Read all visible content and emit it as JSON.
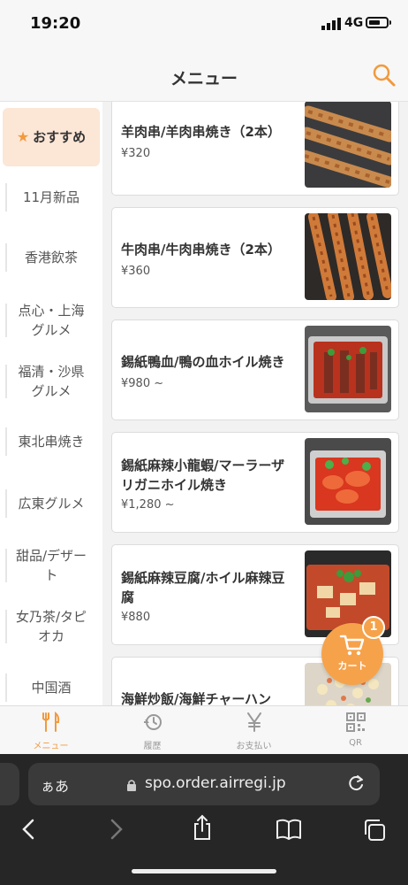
{
  "status": {
    "time": "19:20",
    "network": "4G"
  },
  "header": {
    "title": "メニュー"
  },
  "sidebar": {
    "items": [
      {
        "label": "おすすめ",
        "active": true
      },
      {
        "label": "11月新品"
      },
      {
        "label": "香港飲茶"
      },
      {
        "label": "点心・上海グルメ",
        "line1": "点心・上海",
        "line2": "グルメ"
      },
      {
        "label": "福清・沙県グルメ",
        "line1": "福清・沙県",
        "line2": "グルメ"
      },
      {
        "label": "東北串焼き"
      },
      {
        "label": "広東グルメ"
      },
      {
        "label": "甜品/デザート",
        "line1": "甜品/デザー",
        "line2": "ト"
      },
      {
        "label": "女乃茶/タピオカ",
        "line1": "女乃茶/タピ",
        "line2": "オカ"
      },
      {
        "label": "中国酒"
      }
    ]
  },
  "products": [
    {
      "name": "羊肉串/羊肉串焼き（2本）",
      "price": "¥320"
    },
    {
      "name": "牛肉串/牛肉串焼き（2本）",
      "price": "¥360"
    },
    {
      "name": "錫紙鴨血/鴨の血ホイル焼き",
      "price": "¥980 ~"
    },
    {
      "name": "錫紙麻辣小龍蝦/マーラーザリガニホイル焼き",
      "line1": "錫紙麻辣小龍蝦/マーラーザ",
      "line2": "リガニホイル焼き",
      "price": "¥1,280 ~"
    },
    {
      "name": "錫紙麻辣豆腐/ホイル麻辣豆腐",
      "line1": "錫紙麻辣豆腐/ホイル麻辣豆",
      "line2": "腐",
      "price": "¥880"
    },
    {
      "name": "海鮮炒飯/海鮮チャーハン"
    }
  ],
  "cart": {
    "label": "カート",
    "count": "1"
  },
  "tabbar": {
    "tabs": [
      {
        "label": "メニュー",
        "icon": "fork-knife-icon",
        "active": true
      },
      {
        "label": "履歴",
        "icon": "history-icon"
      },
      {
        "label": "お支払い",
        "icon": "yen-icon"
      },
      {
        "label": "QR",
        "icon": "qr-code-icon"
      }
    ]
  },
  "browser": {
    "text_size_label": "ぁあ",
    "url": "spo.order.airregi.jp"
  },
  "colors": {
    "accent": "#f6a24a",
    "active_bg": "#fce6d6"
  }
}
